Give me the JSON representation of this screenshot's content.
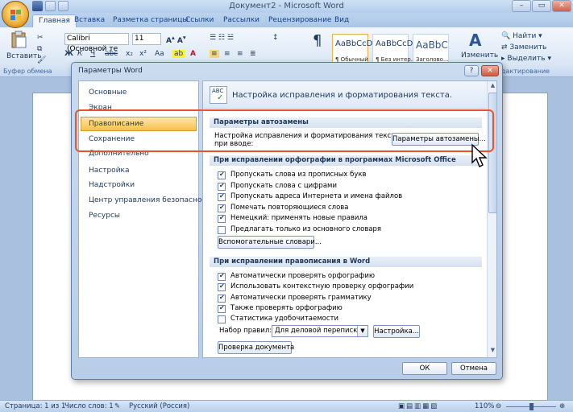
{
  "window": {
    "title": "Документ2 - Microsoft Word",
    "controls": {
      "minimize": "–",
      "maximize": "▭",
      "close": "✕"
    }
  },
  "tabs": [
    "Главная",
    "Вставка",
    "Разметка страницы",
    "Ссылки",
    "Рассылки",
    "Рецензирование",
    "Вид"
  ],
  "ribbon": {
    "paste_label": "Вставить",
    "clipboard_group": "Буфер обмена",
    "font_name": "Calibri (Основной те",
    "font_size": "11",
    "styles": [
      {
        "preview": "AaBbCcDc",
        "name": "¶ Обычный"
      },
      {
        "preview": "AaBbCcDc",
        "name": "¶ Без интер..."
      },
      {
        "preview": "AaBbC",
        "name": "Заголово..."
      }
    ],
    "change_styles": "Изменить",
    "editing": {
      "find": "Найти",
      "replace": "Заменить",
      "select": "Выделить"
    },
    "editing_group": "дактирование"
  },
  "dialog": {
    "title": "Параметры Word",
    "help": "?",
    "close": "✕",
    "nav": [
      "Основные",
      "Экран",
      "Правописание",
      "Сохранение",
      "Дополнительно",
      "Настройка",
      "Надстройки",
      "Центр управления безопасностью",
      "Ресурсы"
    ],
    "selected_nav": "Правописание",
    "banner": "Настройка исправления и форматирования текста.",
    "autocorrect": {
      "header": "Параметры автозамены",
      "desc_line1": "Настройка исправления и форматирования текста",
      "desc_line2": "при вводе:",
      "button": "Параметры автозамены..."
    },
    "office_section": {
      "header": "При исправлении орфографии в программах Microsoft Office",
      "items": [
        {
          "label": "Пропускать слова из прописных букв",
          "checked": true
        },
        {
          "label": "Пропускать слова с цифрами",
          "checked": true
        },
        {
          "label": "Пропускать адреса Интернета и имена файлов",
          "checked": true
        },
        {
          "label": "Помечать повторяющиеся слова",
          "checked": true
        },
        {
          "label": "Немецкий: применять новые правила",
          "checked": true
        },
        {
          "label": "Предлагать только из основного словаря",
          "checked": false
        }
      ],
      "dict_button": "Вспомогательные словари..."
    },
    "word_section": {
      "header": "При исправлении правописания в Word",
      "items": [
        {
          "label": "Автоматически проверять орфографию",
          "checked": true
        },
        {
          "label": "Использовать контекстную проверку орфографии",
          "checked": true
        },
        {
          "label": "Автоматически проверять грамматику",
          "checked": true
        },
        {
          "label": "Также проверять орфографию",
          "checked": true
        },
        {
          "label": "Статистика удобочитаемости",
          "checked": false
        }
      ],
      "rules_label": "Набор правил:",
      "rules_value": "Для деловой переписки",
      "settings_button": "Настройка...",
      "check_button": "Проверка документа"
    },
    "ok": "ОК",
    "cancel": "Отмена"
  },
  "status": {
    "page": "Страница: 1 из 1",
    "words": "Число слов: 1",
    "language": "Русский (Россия)",
    "zoom": "110%"
  },
  "colors": {
    "highlight": "#e8542a",
    "selection": "#f9c04e",
    "accent": "#15428b"
  }
}
